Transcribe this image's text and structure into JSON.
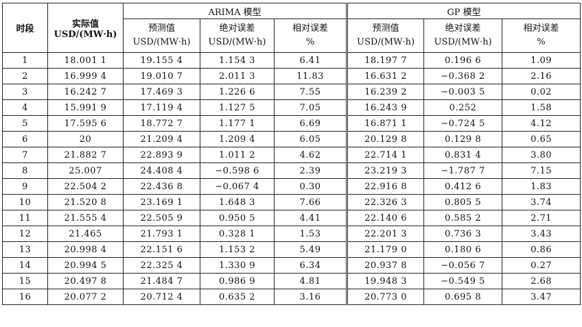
{
  "header": {
    "period_label": "时段",
    "actual_label_line1": "实际值",
    "actual_label_line2": "USD/(MW·h)",
    "arima_group": "ARIMA 模型",
    "gp_group": "GP 模型",
    "arima_cols": [
      {
        "line1": "预测值",
        "line2": "USD/(MW·h)"
      },
      {
        "line1": "绝对误差",
        "line2": "USD/(MW·h)"
      },
      {
        "line1": "相对误差",
        "line2": "%"
      }
    ],
    "gp_cols": [
      {
        "line1": "预测值",
        "line2": "USD/(MW·h)"
      },
      {
        "line1": "绝对误差",
        "line2": "USD/(MW·h)"
      },
      {
        "line1": "相对误差",
        "line2": "%"
      }
    ]
  },
  "rows": [
    [
      "1",
      "18.001 1",
      "19.155 4",
      "1.154 3",
      "6.41",
      "18.197 7",
      "0.196 6",
      "1.09"
    ],
    [
      "2",
      "16.999 4",
      "19.010 7",
      "2.011 3",
      "11.83",
      "16.631 2",
      "−0.368 2",
      "2.16"
    ],
    [
      "3",
      "16.242 7",
      "17.469 3",
      "1.226 6",
      "7.55",
      "16.239 2",
      "−0.003 5",
      "0.02"
    ],
    [
      "4",
      "15.991 9",
      "17.119 4",
      "1.127 5",
      "7.05",
      "16.243 9",
      "0.252",
      "1.58"
    ],
    [
      "5",
      "17.595 6",
      "18.772 7",
      "1.177 1",
      "6.69",
      "16.871 1",
      "−0.724 5",
      "4.12"
    ],
    [
      "6",
      "20",
      "21.209 4",
      "1.209 4",
      "6.05",
      "20.129 8",
      "0.129 8",
      "0.65"
    ],
    [
      "7",
      "21.882 7",
      "22.893 9",
      "1.011 2",
      "4.62",
      "22.714 1",
      "0.831 4",
      "3.80"
    ],
    [
      "8",
      "25.007",
      "24.408 4",
      "−0.598 6",
      "2.39",
      "23.219 3",
      "−1.787 7",
      "7.15"
    ],
    [
      "9",
      "22.504 2",
      "22.436 8",
      "−0.067 4",
      "0.30",
      "22.916 8",
      "0.412 6",
      "1.83"
    ],
    [
      "10",
      "21.520 8",
      "23.169 1",
      "1.648 3",
      "7.66",
      "22.326 3",
      "0.805 5",
      "3.74"
    ],
    [
      "11",
      "21.555 4",
      "22.505 9",
      "0.950 5",
      "4.41",
      "22.140 6",
      "0.585 2",
      "2.71"
    ],
    [
      "12",
      "21.465",
      "21.793 1",
      "0.328 1",
      "1.53",
      "22.201 3",
      "0.736 3",
      "3.43"
    ],
    [
      "13",
      "20.998 4",
      "22.151 6",
      "1.153 2",
      "5.49",
      "21.179 0",
      "0.180 6",
      "0.86"
    ],
    [
      "14",
      "20.994 5",
      "22.325 4",
      "1.330 9",
      "6.34",
      "20.937 8",
      "−0.056 7",
      "0.27"
    ],
    [
      "15",
      "20.497 8",
      "21.484 7",
      "0.986 9",
      "4.81",
      "19.948 3",
      "−0.549 5",
      "2.68"
    ],
    [
      "16",
      "20.077 2",
      "20.712 4",
      "0.635 2",
      "3.16",
      "20.773 0",
      "0.695 8",
      "3.47"
    ]
  ]
}
